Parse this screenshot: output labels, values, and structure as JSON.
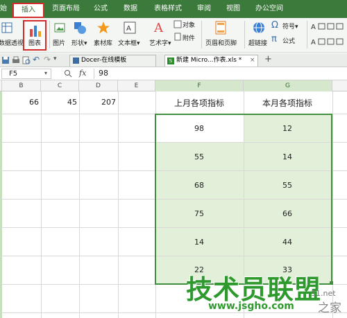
{
  "menubar": {
    "items": [
      "始",
      "插入",
      "页面布局",
      "公式",
      "数据",
      "表格样式",
      "审阅",
      "视图",
      "办公空间"
    ],
    "active_index": 1
  },
  "ribbon": {
    "pivot_label": "数据透视表",
    "chart_label": "图表",
    "picture_label": "图片",
    "shape_label": "形状",
    "material_label": "素材库",
    "textbox_label": "文本框",
    "wordart_label": "艺术字",
    "object_label": "对象",
    "attachment_label": "附件",
    "header_footer_label": "页眉和页脚",
    "hyperlink_label": "超链接",
    "symbol_label": "符号",
    "formula_label": "公式",
    "dropdown_glyph": "▾"
  },
  "tabs": [
    {
      "label": "Docer-在线模板"
    },
    {
      "label": "新建 Micro...作表.xls *"
    }
  ],
  "add_tab_glyph": "+",
  "formula_bar": {
    "cell_ref": "F5",
    "fx": "fx",
    "value": "98"
  },
  "columns": [
    "B",
    "C",
    "D",
    "E",
    "F",
    "G"
  ],
  "row1": {
    "b": "66",
    "c": "45",
    "d": "207"
  },
  "table": {
    "headers": [
      "上月各项指标",
      "本月各项指标"
    ],
    "rows": [
      [
        "98",
        "12"
      ],
      [
        "55",
        "14"
      ],
      [
        "68",
        "55"
      ],
      [
        "75",
        "66"
      ],
      [
        "14",
        "44"
      ],
      [
        "22",
        "33"
      ]
    ]
  },
  "watermark": {
    "title": "技术员联盟",
    "url": "www.jsgho.com",
    "corner": "之家",
    "corner_url": "51.net"
  },
  "colors": {
    "menubar": "#3b7a3b",
    "highlight": "#d42a2a",
    "selection_border": "#3f8f3f",
    "selection_fill": "#e2f0da",
    "watermark": "#2e8b2e"
  }
}
